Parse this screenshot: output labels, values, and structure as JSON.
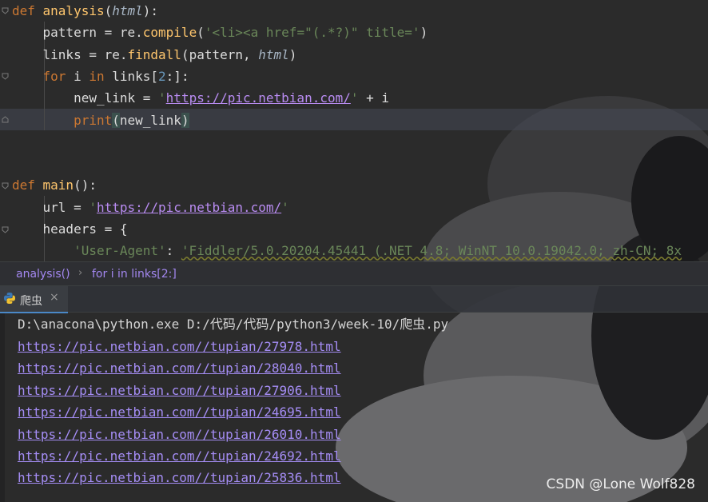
{
  "editor": {
    "lines": [
      {
        "parts": [
          [
            "kw",
            "def "
          ],
          [
            "fn",
            "analysis"
          ],
          [
            "",
            "("
          ],
          [
            "param",
            "html"
          ],
          [
            "",
            "):"
          ]
        ]
      },
      {
        "parts": [
          [
            "",
            "    pattern = re."
          ],
          [
            "fn",
            "compile"
          ],
          [
            "",
            "("
          ],
          [
            "str",
            "'<li><a href=\"(.*?)\" title='"
          ],
          [
            "",
            ")"
          ]
        ]
      },
      {
        "parts": [
          [
            "",
            "    links = re."
          ],
          [
            "fn",
            "findall"
          ],
          [
            "",
            "(pattern, "
          ],
          [
            "param",
            "html"
          ],
          [
            "",
            ")"
          ]
        ]
      },
      {
        "parts": [
          [
            "kw",
            "    for "
          ],
          [
            "",
            "i "
          ],
          [
            "kw",
            "in "
          ],
          [
            "",
            "links["
          ],
          [
            "num",
            "2"
          ],
          [
            "",
            ":]:"
          ]
        ]
      },
      {
        "parts": [
          [
            "",
            "        new_link = "
          ],
          [
            "str",
            "'"
          ],
          [
            "url",
            "https://pic.netbian.com/"
          ],
          [
            "str",
            "'"
          ],
          [
            "",
            " + i"
          ]
        ]
      },
      {
        "parts": [
          [
            "",
            "        "
          ],
          [
            "kw",
            "print"
          ],
          [
            "paren",
            "("
          ],
          [
            "",
            "new_link"
          ],
          [
            "paren",
            ")"
          ]
        ]
      },
      {
        "parts": []
      },
      {
        "parts": []
      },
      {
        "parts": [
          [
            "kw",
            "def "
          ],
          [
            "fn",
            "main"
          ],
          [
            "",
            "():"
          ]
        ]
      },
      {
        "parts": [
          [
            "",
            "    url = "
          ],
          [
            "str",
            "'"
          ],
          [
            "url",
            "https://pic.netbian.com/"
          ],
          [
            "str",
            "'"
          ]
        ]
      },
      {
        "parts": [
          [
            "",
            "    headers = {"
          ]
        ]
      },
      {
        "parts": [
          [
            "",
            "        "
          ],
          [
            "str",
            "'User-Agent'"
          ],
          [
            "",
            ": "
          ],
          [
            "ua",
            "'Fiddler/5.0.20204.45441 (.NET 4.8; WinNT 10.0.19042.0; zh-CN; 8x"
          ]
        ]
      }
    ]
  },
  "breadcrumb": {
    "item1": "analysis()",
    "separator": "›",
    "item2": "for i in links[2:]"
  },
  "run_tab": {
    "label": "爬虫",
    "close": "×"
  },
  "console": {
    "command": "D:\\anacona\\python.exe D:/代码/代码/python3/week-10/爬虫.py",
    "links": [
      "https://pic.netbian.com//tupian/27978.html",
      "https://pic.netbian.com//tupian/28040.html",
      "https://pic.netbian.com//tupian/27906.html",
      "https://pic.netbian.com//tupian/24695.html",
      "https://pic.netbian.com//tupian/26010.html",
      "https://pic.netbian.com//tupian/24692.html",
      "https://pic.netbian.com//tupian/25836.html"
    ]
  },
  "watermark": "CSDN @Lone Wolf828",
  "colors": {
    "background": "#2b2b2b",
    "keyword": "#cc7832",
    "function": "#ffc66d",
    "string": "#6a8759",
    "link": "#a58df5",
    "number": "#6897bb"
  },
  "icons": {
    "run_tab_icon": "python-icon",
    "fold_markers": "fold-icon"
  }
}
